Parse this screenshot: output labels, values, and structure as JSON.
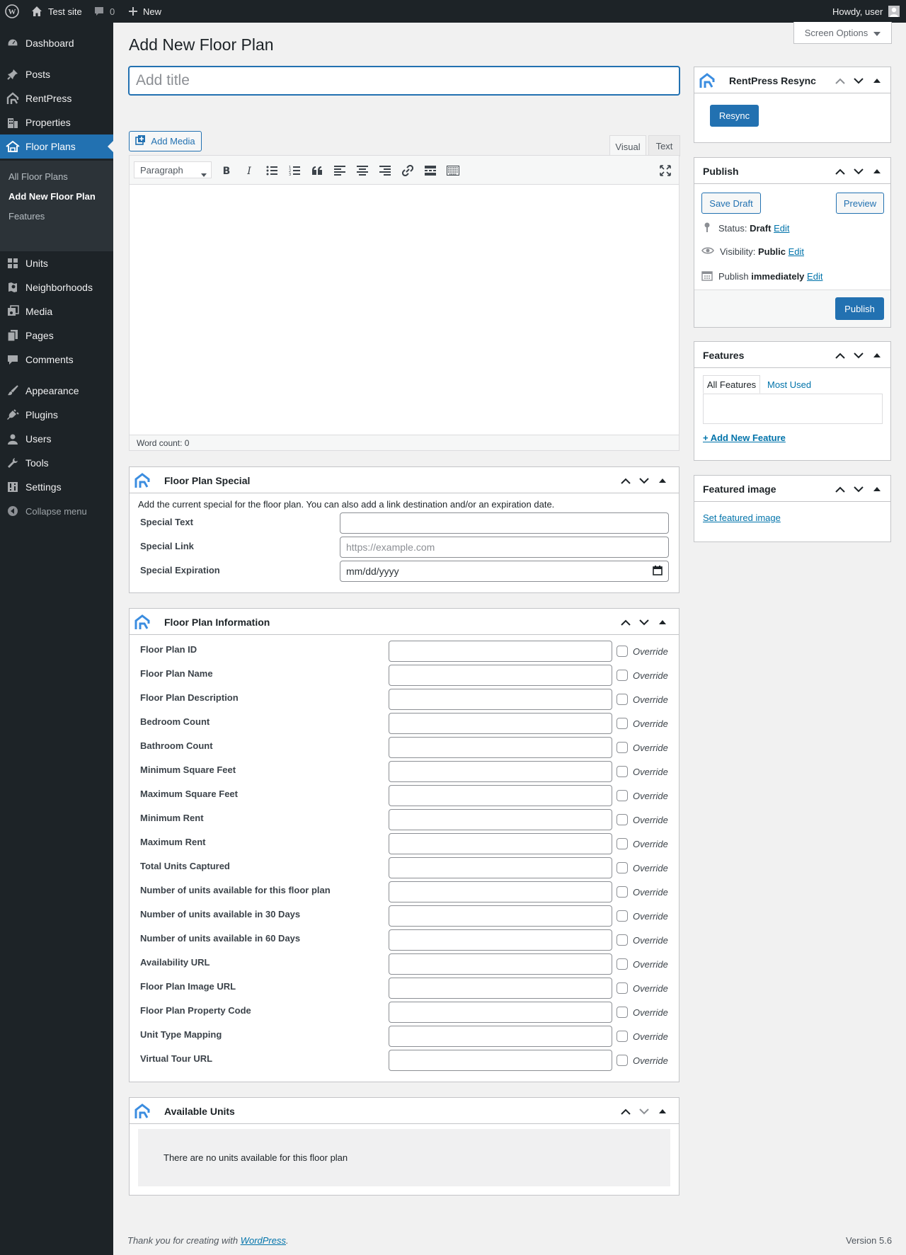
{
  "admin_bar": {
    "site_name": "Test site",
    "comments_count": "0",
    "new_label": "New",
    "howdy": "Howdy, user"
  },
  "menu": {
    "items": [
      {
        "label": "Dashboard",
        "icon": "dashboard-icon"
      },
      {
        "label": "Posts",
        "icon": "pin-icon"
      },
      {
        "label": "RentPress",
        "icon": "rentpress-icon"
      },
      {
        "label": "Properties",
        "icon": "building-icon"
      },
      {
        "label": "Floor Plans",
        "icon": "floorplan-icon"
      },
      {
        "label": "Units",
        "icon": "grid-icon"
      },
      {
        "label": "Neighborhoods",
        "icon": "location-icon"
      },
      {
        "label": "Media",
        "icon": "media-icon"
      },
      {
        "label": "Pages",
        "icon": "page-icon"
      },
      {
        "label": "Comments",
        "icon": "comment-icon"
      },
      {
        "label": "Appearance",
        "icon": "brush-icon"
      },
      {
        "label": "Plugins",
        "icon": "plug-icon"
      },
      {
        "label": "Users",
        "icon": "user-icon"
      },
      {
        "label": "Tools",
        "icon": "wrench-icon"
      },
      {
        "label": "Settings",
        "icon": "settings-icon"
      }
    ],
    "submenu": [
      "All Floor Plans",
      "Add New Floor Plan",
      "Features"
    ],
    "collapse": "Collapse menu"
  },
  "page": {
    "title": "Add New Floor Plan",
    "screen_options": "Screen Options",
    "title_placeholder": "Add title"
  },
  "editor": {
    "add_media": "Add Media",
    "tab_visual": "Visual",
    "tab_text": "Text",
    "format": "Paragraph",
    "word_count": "Word count: 0"
  },
  "special": {
    "title": "Floor Plan Special",
    "description": "Add the current special for the floor plan. You can also add a link destination and/or an expiration date.",
    "fields": [
      {
        "label": "Special Text",
        "value": "",
        "placeholder": ""
      },
      {
        "label": "Special Link",
        "value": "",
        "placeholder": "https://example.com"
      },
      {
        "label": "Special Expiration",
        "value": "mm/dd/yyyy",
        "placeholder": ""
      }
    ]
  },
  "info": {
    "title": "Floor Plan Information",
    "override_label": "Override",
    "fields": [
      "Floor Plan ID",
      "Floor Plan Name",
      "Floor Plan Description",
      "Bedroom Count",
      "Bathroom Count",
      "Minimum Square Feet",
      "Maximum Square Feet",
      "Minimum Rent",
      "Maximum Rent",
      "Total Units Captured",
      "Number of units available for this floor plan",
      "Number of units available in 30 Days",
      "Number of units available in 60 Days",
      "Availability URL",
      "Floor Plan Image URL",
      "Floor Plan Property Code",
      "Unit Type Mapping",
      "Virtual Tour URL"
    ]
  },
  "units": {
    "title": "Available Units",
    "empty": "There are no units available for this floor plan"
  },
  "resync": {
    "title": "RentPress Resync",
    "button": "Resync"
  },
  "publish": {
    "title": "Publish",
    "save_draft": "Save Draft",
    "preview": "Preview",
    "status_label": "Status:",
    "status_value": "Draft",
    "visibility_label": "Visibility:",
    "visibility_value": "Public",
    "schedule_label": "Publish",
    "schedule_value": "immediately",
    "edit": "Edit",
    "publish_button": "Publish"
  },
  "features": {
    "title": "Features",
    "tab_all": "All Features",
    "tab_used": "Most Used",
    "add_new": "+ Add New Feature"
  },
  "featured_image": {
    "title": "Featured image",
    "link": "Set featured image"
  },
  "footer": {
    "thanks_prefix": "Thank you for creating with ",
    "wp_link": "WordPress",
    "thanks_suffix": ".",
    "version": "Version 5.6"
  },
  "colors": {
    "primary": "#2271b1",
    "admin_dark": "#1d2327",
    "rentpress_blue": "#3b8de0"
  }
}
